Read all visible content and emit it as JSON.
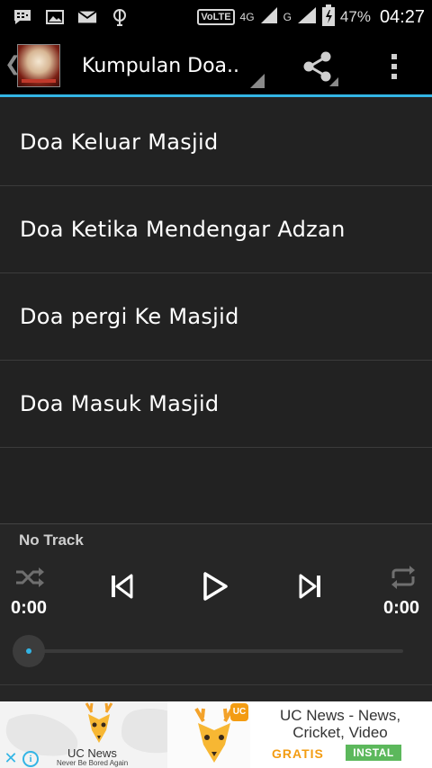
{
  "status_bar": {
    "icons_left": [
      "bbm-icon",
      "gallery-icon",
      "mail-icon",
      "sync-icon"
    ],
    "volte": "VoLTE",
    "network_1": "4G",
    "network_2": "G",
    "battery_percent": "47%",
    "time": "04:27"
  },
  "action_bar": {
    "title": "Kumpulan Doa..",
    "icons": [
      "up-chevron-icon",
      "app-logo",
      "share-icon",
      "overflow-menu-icon"
    ]
  },
  "list": {
    "items": [
      {
        "label": "Doa Keluar Masjid"
      },
      {
        "label": "Doa Ketika Mendengar Adzan"
      },
      {
        "label": "Doa pergi Ke Masjid"
      },
      {
        "label": "Doa Masuk Masjid"
      }
    ]
  },
  "player": {
    "track": "No Track",
    "elapsed": "0:00",
    "duration": "0:00",
    "progress": 0,
    "icons": [
      "shuffle-icon",
      "previous-icon",
      "play-icon",
      "next-icon",
      "repeat-icon"
    ],
    "accent_color": "#33b5e5"
  },
  "ad": {
    "brand_name": "UC News",
    "brand_tagline": "Never Be Bored Again",
    "title_line1": "UC News - News,",
    "title_line2": "Cricket, Video",
    "price": "GRATIS",
    "install_label": "INSTAL",
    "close_glyph": "✕",
    "info_glyph": "i",
    "icons": [
      "deer-logo-icon",
      "close-icon",
      "info-icon"
    ]
  }
}
